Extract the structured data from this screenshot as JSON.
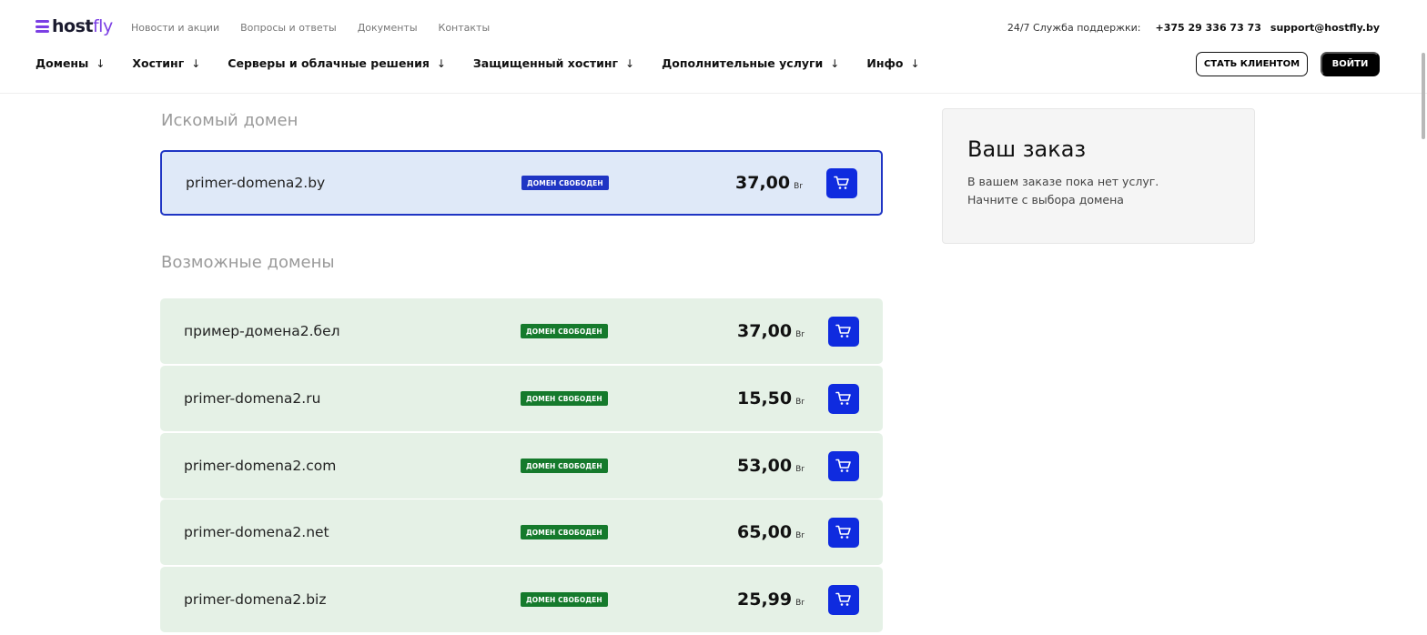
{
  "logo": {
    "host": "host",
    "fly": "fly"
  },
  "top_nav": [
    "Новости и акции",
    "Вопросы и ответы",
    "Документы",
    "Контакты"
  ],
  "support": {
    "label": "24/7 Служба поддержки:",
    "phone": "+375 29 336 73 73",
    "email": "support@hostfly.by"
  },
  "main_nav": [
    {
      "label": "Домены",
      "icon": "arrow-down-icon"
    },
    {
      "label": "Хостинг",
      "icon": "arrow-down-icon"
    },
    {
      "label": "Серверы и облачные решения",
      "icon": "arrow-down-icon"
    },
    {
      "label": "Защищенный хостинг",
      "icon": "arrow-down-icon"
    },
    {
      "label": "Дополнительные услуги",
      "icon": "arrow-down-icon"
    },
    {
      "label": "Инфо",
      "icon": "arrow-down-icon"
    }
  ],
  "buttons": {
    "become_client": "СТАТЬ КЛИЕНТОМ",
    "login": "ВОЙТИ"
  },
  "searched": {
    "title": "Искомый домен",
    "domain": {
      "name": "primer-domena2.by",
      "status": "ДОМЕН СВОБОДЕН",
      "price": "37,00",
      "currency": "Br",
      "cart_icon": "cart-icon"
    }
  },
  "possible": {
    "title": "Возможные домены",
    "domains": [
      {
        "name": "пример-домена2.бел",
        "status": "ДОМЕН СВОБОДЕН",
        "price": "37,00",
        "currency": "Br"
      },
      {
        "name": "primer-domena2.ru",
        "status": "ДОМЕН СВОБОДЕН",
        "price": "15,50",
        "currency": "Br"
      },
      {
        "name": "primer-domena2.com",
        "status": "ДОМЕН СВОБОДЕН",
        "price": "53,00",
        "currency": "Br"
      },
      {
        "name": "primer-domena2.net",
        "status": "ДОМЕН СВОБОДЕН",
        "price": "65,00",
        "currency": "Br"
      },
      {
        "name": "primer-domena2.biz",
        "status": "ДОМЕН СВОБОДЕН",
        "price": "25,99",
        "currency": "Br"
      }
    ]
  },
  "order": {
    "title": "Ваш заказ",
    "text": "В вашем заказе пока нет услуг. Начните с выбора домена"
  },
  "colors": {
    "accent": "#0f2bdf",
    "brand": "#7b3fe4",
    "available_badge": "#157a2c",
    "searched_bg": "#dfe9f8",
    "row_bg": "#e5f1e6"
  }
}
